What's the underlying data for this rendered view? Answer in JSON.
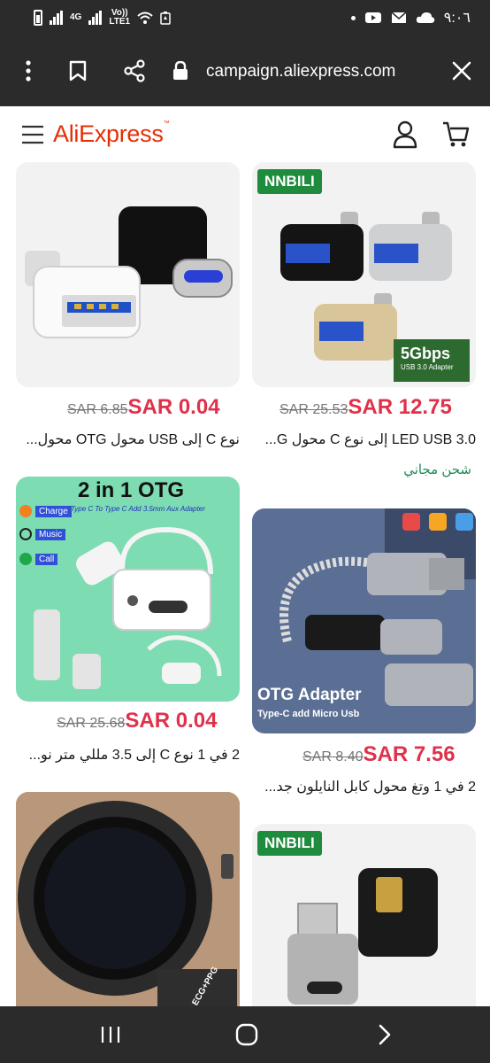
{
  "status_bar": {
    "time": "٩:٠٦",
    "network_4g": "4G",
    "volte": "Vo))",
    "lte": "LTE1"
  },
  "browser": {
    "url": "campaign.aliexpress.com",
    "menu_icon": "more-vert-icon",
    "bookmark_icon": "bookmark-icon",
    "share_icon": "share-icon",
    "lock_icon": "lock-icon",
    "close_icon": "close-icon"
  },
  "site": {
    "logo_text": "AliExpress",
    "logo_tm": "™",
    "brand_color": "#e62e04"
  },
  "products": [
    {
      "old_price": "SAR 6.85",
      "price": "SAR 0.04",
      "title": "نوع C إلى USB محول OTG محول...",
      "shipping": ""
    },
    {
      "old_price": "SAR 25.53",
      "price": "SAR 12.75",
      "title": "LED USB 3.0 إلى نوع C محول G...",
      "shipping": "شحن مجاني",
      "badge": "NNBILI",
      "image_text_1": "5Gbps",
      "image_text_2": "USB 3.0 Adapter"
    },
    {
      "old_price": "SAR 25.68",
      "price": "SAR 0.04",
      "title": "2 في 1 نوع C إلى 3.5 مللي متر نو...",
      "shipping": "",
      "image_title": "2 in 1 OTG",
      "image_subtitle": "Type C To Type C Add 3.5mm Aux Adapter",
      "feature_1": "Charge",
      "feature_2": "Music",
      "feature_3": "Call"
    },
    {
      "old_price": "SAR 8.40",
      "price": "SAR 7.56",
      "title": "2 في 1 وتغ محول كابل النايلون جد...",
      "shipping": "",
      "image_title": "OTG Adapter",
      "image_subtitle": "Type-C add Micro Usb"
    },
    {
      "old_price": "",
      "price": "",
      "title": "",
      "image_text": "ECG+PPG"
    },
    {
      "old_price": "",
      "price": "",
      "title": "",
      "badge": "NNBILI"
    }
  ],
  "nav": {
    "recents_icon": "recents-icon",
    "home_icon": "home-icon",
    "back_icon": "back-icon"
  },
  "colors": {
    "price_red": "#e0314b",
    "free_shipping_green": "#1e8a53",
    "chrome_dark": "#2b2b2b",
    "nnbili_green": "#1f8b3c"
  }
}
